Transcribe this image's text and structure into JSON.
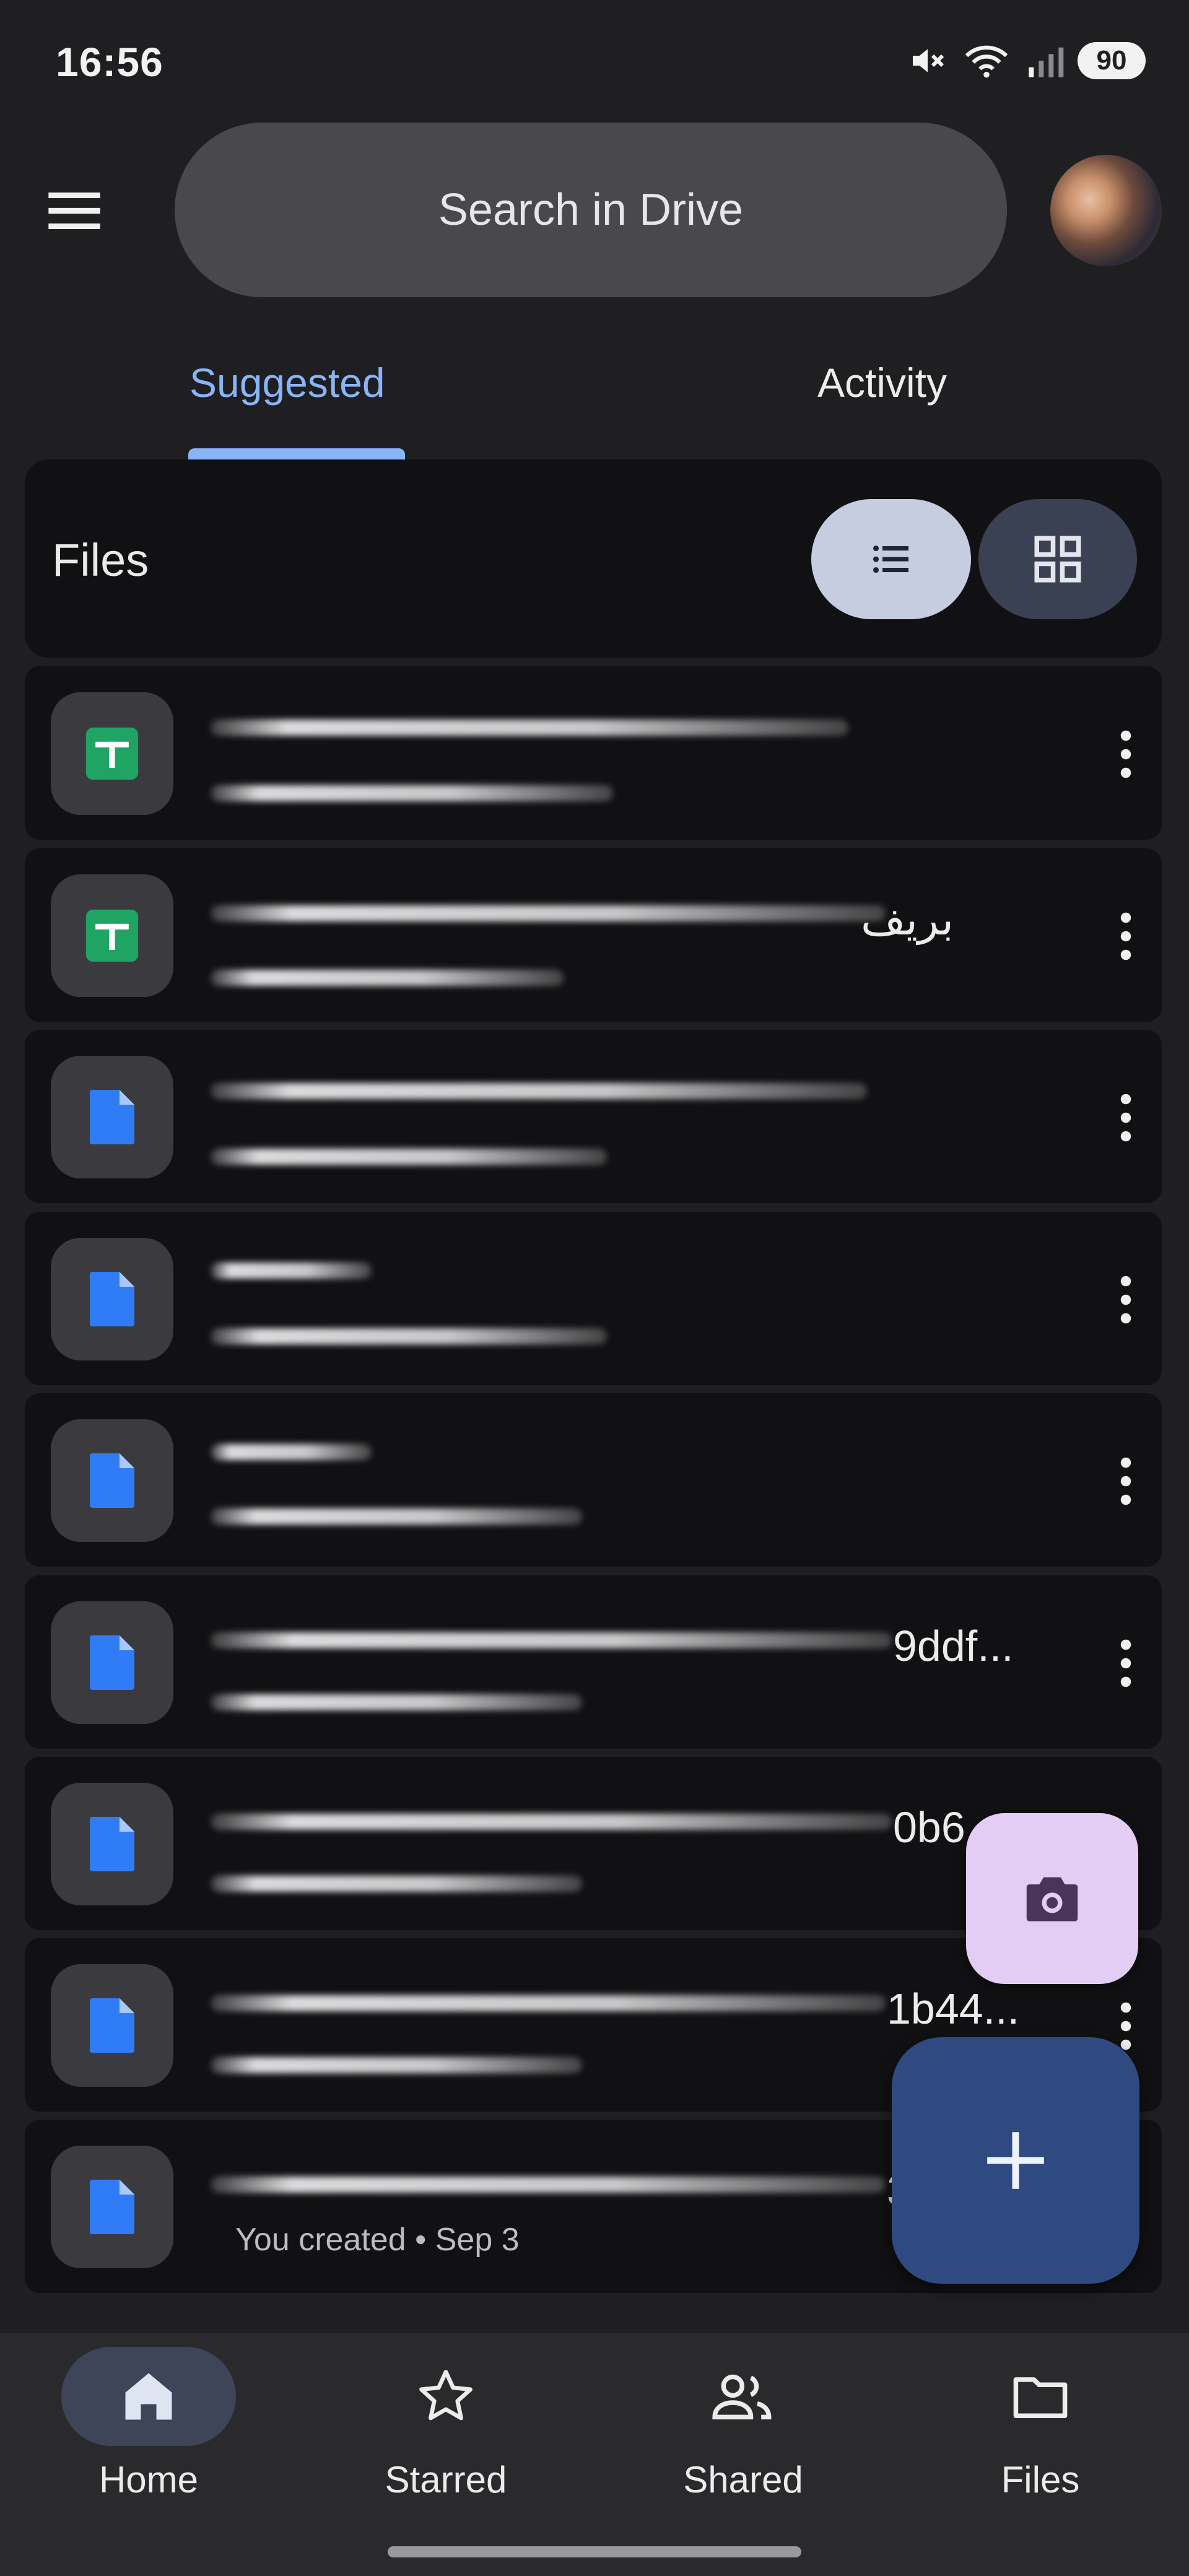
{
  "status_bar": {
    "time": "16:56",
    "battery": "90",
    "icons": [
      "mute-icon",
      "wifi-icon",
      "signal-icon"
    ]
  },
  "top_bar": {
    "menu_icon": "hamburger-icon",
    "search_placeholder": "Search in Drive",
    "avatar_icon": "account-avatar"
  },
  "tabs": [
    {
      "label": "Suggested",
      "active": true
    },
    {
      "label": "Activity",
      "active": false
    }
  ],
  "files_section": {
    "title": "Files",
    "view_modes": [
      "list-view-icon",
      "grid-view-icon"
    ],
    "active_view": "list"
  },
  "files": [
    {
      "type": "sheets",
      "icon": "sheets-icon",
      "visible_name_suffix": "",
      "subtitle": ""
    },
    {
      "type": "sheets",
      "icon": "sheets-icon",
      "visible_name_suffix": "بريف",
      "subtitle": ""
    },
    {
      "type": "docs",
      "icon": "docs-icon",
      "visible_name_suffix": "",
      "subtitle": ""
    },
    {
      "type": "docs",
      "icon": "docs-icon",
      "visible_name_suffix": "",
      "subtitle": ""
    },
    {
      "type": "docs",
      "icon": "docs-icon",
      "visible_name_suffix": "",
      "subtitle": ""
    },
    {
      "type": "docs",
      "icon": "docs-icon",
      "visible_name_suffix": "9ddf...",
      "subtitle": ""
    },
    {
      "type": "docs",
      "icon": "docs-icon",
      "visible_name_suffix": "0b6...",
      "subtitle": ""
    },
    {
      "type": "docs",
      "icon": "docs-icon",
      "visible_name_suffix": "1b44...",
      "subtitle": ""
    },
    {
      "type": "docs",
      "icon": "docs-icon",
      "visible_name_suffix": "3",
      "subtitle": "You created • Sep 3"
    }
  ],
  "fabs": {
    "camera_icon": "camera-icon",
    "new_icon": "plus-icon"
  },
  "bottom_nav": [
    {
      "label": "Home",
      "icon": "home-icon",
      "active": true
    },
    {
      "label": "Starred",
      "icon": "star-icon",
      "active": false
    },
    {
      "label": "Shared",
      "icon": "shared-people-icon",
      "active": false
    },
    {
      "label": "Files",
      "icon": "folder-icon",
      "active": false
    }
  ]
}
